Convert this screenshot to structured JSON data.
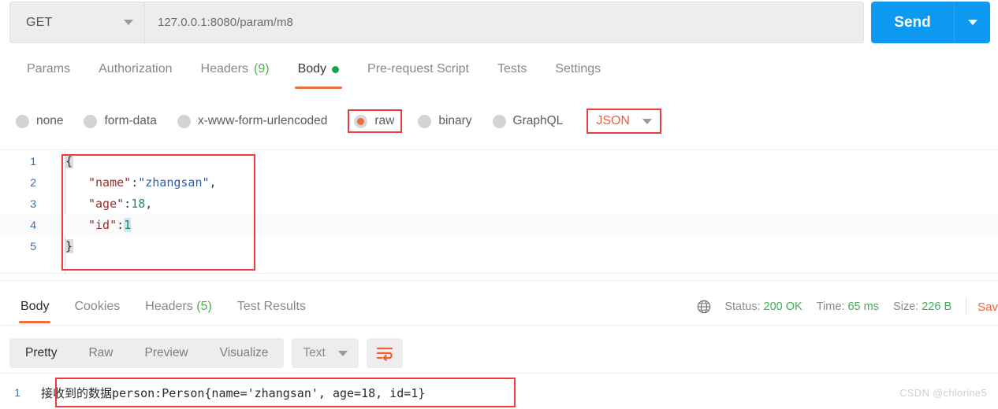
{
  "request": {
    "method": "GET",
    "method_icon": "chevron-down-icon",
    "url": "127.0.0.1:8080/param/m8",
    "send_label": "Send",
    "send_caret_icon": "chevron-down-icon"
  },
  "request_tabs": [
    {
      "label": "Params",
      "count": "",
      "active": false
    },
    {
      "label": "Authorization",
      "count": "",
      "active": false
    },
    {
      "label": "Headers",
      "count": "(9)",
      "active": false
    },
    {
      "label": "Body",
      "count": "",
      "active": true,
      "dot": true
    },
    {
      "label": "Pre-request Script",
      "count": "",
      "active": false
    },
    {
      "label": "Tests",
      "count": "",
      "active": false
    },
    {
      "label": "Settings",
      "count": "",
      "active": false
    }
  ],
  "body_types": [
    {
      "label": "none",
      "selected": false,
      "boxed": false
    },
    {
      "label": "form-data",
      "selected": false,
      "boxed": false
    },
    {
      "label": "x-www-form-urlencoded",
      "selected": false,
      "boxed": false
    },
    {
      "label": "raw",
      "selected": true,
      "boxed": true
    },
    {
      "label": "binary",
      "selected": false,
      "boxed": false
    },
    {
      "label": "GraphQL",
      "selected": false,
      "boxed": false
    }
  ],
  "body_format": {
    "label": "JSON",
    "caret_icon": "chevron-down-icon",
    "boxed": true
  },
  "editor": {
    "lines": [
      {
        "no": "1",
        "indent": 0,
        "tokens": [
          {
            "t": "{",
            "c": "brace"
          }
        ]
      },
      {
        "no": "2",
        "indent": 1,
        "tokens": [
          {
            "t": "\"name\"",
            "c": "k-key"
          },
          {
            "t": ":",
            "c": "k-pun"
          },
          {
            "t": "\"zhangsan\"",
            "c": "k-str"
          },
          {
            "t": ",",
            "c": "k-pun"
          }
        ]
      },
      {
        "no": "3",
        "indent": 1,
        "tokens": [
          {
            "t": "\"age\"",
            "c": "k-key"
          },
          {
            "t": ":",
            "c": "k-pun"
          },
          {
            "t": "18",
            "c": "k-num"
          },
          {
            "t": ",",
            "c": "k-pun"
          }
        ]
      },
      {
        "no": "4",
        "indent": 1,
        "tokens": [
          {
            "t": "\"id\"",
            "c": "k-key"
          },
          {
            "t": ":",
            "c": "k-pun"
          },
          {
            "t": "1",
            "c": "k-num hl-sel"
          }
        ]
      },
      {
        "no": "5",
        "indent": 0,
        "tokens": [
          {
            "t": "}",
            "c": "brace"
          }
        ]
      }
    ]
  },
  "response_tabs": [
    {
      "label": "Body",
      "count": "",
      "active": true
    },
    {
      "label": "Cookies",
      "count": "",
      "active": false
    },
    {
      "label": "Headers",
      "count": "(5)",
      "active": false
    },
    {
      "label": "Test Results",
      "count": "",
      "active": false
    }
  ],
  "response_meta": {
    "globe_icon": "globe-icon",
    "status_label": "Status:",
    "status_value": "200 OK",
    "time_label": "Time:",
    "time_value": "65 ms",
    "size_label": "Size:",
    "size_value": "226 B",
    "save_label": "Sav"
  },
  "response_toolbar": {
    "views": [
      {
        "label": "Pretty",
        "active": true
      },
      {
        "label": "Raw",
        "active": false
      },
      {
        "label": "Preview",
        "active": false
      },
      {
        "label": "Visualize",
        "active": false
      }
    ],
    "format": {
      "label": "Text",
      "caret_icon": "chevron-down-icon"
    },
    "wrap_icon": "word-wrap-icon"
  },
  "response_body": {
    "line_no": "1",
    "text": "接收到的数据person:Person{name='zhangsan', age=18, id=1}"
  },
  "watermark": "CSDN @chlorine5",
  "colors": {
    "accent_orange": "#f26b3a",
    "send_blue": "#0d99f2",
    "status_green": "#3fae55",
    "annotation_red": "#f23a3a",
    "json_key": "#9b2c2c",
    "json_string": "#2a5db0",
    "json_number": "#1d8a5c"
  }
}
